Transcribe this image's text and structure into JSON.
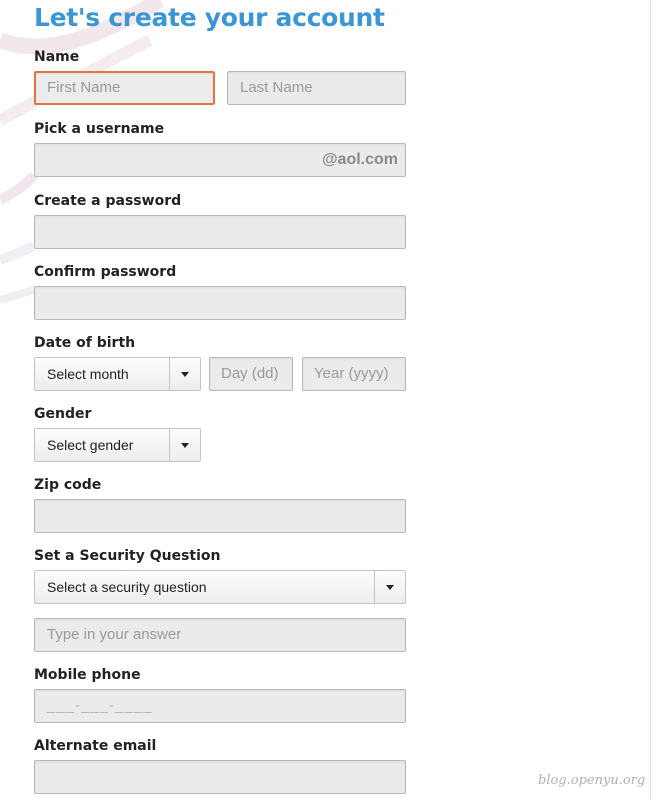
{
  "form": {
    "title": "Let's create your account",
    "name": {
      "label": "Name",
      "first_placeholder": "First Name",
      "last_placeholder": "Last Name"
    },
    "username": {
      "label": "Pick a username",
      "suffix": "@aol.com"
    },
    "password": {
      "label": "Create a password"
    },
    "confirm_password": {
      "label": "Confirm password"
    },
    "date_of_birth": {
      "label": "Date of birth",
      "month_select": "Select month",
      "day_placeholder": "Day (dd)",
      "year_placeholder": "Year (yyyy)"
    },
    "gender": {
      "label": "Gender",
      "select": "Select gender"
    },
    "zip": {
      "label": "Zip code"
    },
    "security": {
      "label": "Set a Security Question",
      "select": "Select a security question",
      "answer_placeholder": "Type in your answer"
    },
    "mobile": {
      "label": "Mobile phone",
      "mask": "___-___-____"
    },
    "alternate_email": {
      "label": "Alternate email"
    }
  },
  "watermark": "blog.openyu.org",
  "colors": {
    "title": "#3b96d6",
    "focus_border": "#e8743b",
    "field_background": "#ebebeb"
  }
}
